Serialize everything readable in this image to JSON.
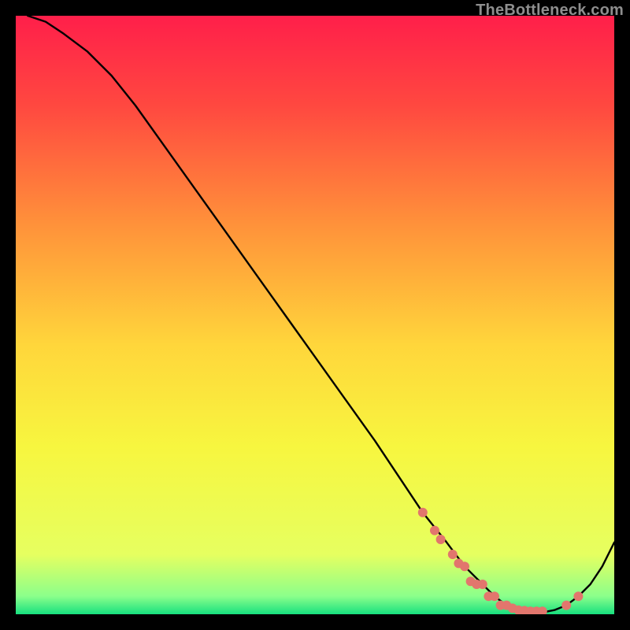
{
  "brand": "TheBottleneck.com",
  "colors": {
    "curve": "#000000",
    "marker": "#e2766d",
    "frame": "#000000"
  },
  "chart_data": {
    "type": "line",
    "title": "",
    "xlabel": "",
    "ylabel": "",
    "xlim": [
      0,
      100
    ],
    "ylim": [
      0,
      100
    ],
    "gradient_stops": [
      {
        "offset": 0.0,
        "color": "#ff1f4a"
      },
      {
        "offset": 0.15,
        "color": "#ff4840"
      },
      {
        "offset": 0.35,
        "color": "#ff923a"
      },
      {
        "offset": 0.55,
        "color": "#ffd63b"
      },
      {
        "offset": 0.72,
        "color": "#f7f63f"
      },
      {
        "offset": 0.9,
        "color": "#e6ff60"
      },
      {
        "offset": 0.97,
        "color": "#8bff8b"
      },
      {
        "offset": 1.0,
        "color": "#17e07f"
      }
    ],
    "series": [
      {
        "name": "bottleneck-curve",
        "x": [
          2,
          5,
          8,
          12,
          16,
          20,
          25,
          30,
          35,
          40,
          45,
          50,
          55,
          60,
          64,
          68,
          72,
          75,
          78,
          80,
          82,
          84,
          86,
          88,
          90,
          92,
          94,
          96,
          98,
          100
        ],
        "y": [
          100,
          99,
          97,
          94,
          90,
          85,
          78,
          71,
          64,
          57,
          50,
          43,
          36,
          29,
          23,
          17,
          12,
          8,
          5,
          3,
          1.5,
          0.7,
          0.3,
          0.3,
          0.7,
          1.5,
          3,
          5,
          8,
          12
        ]
      }
    ],
    "markers": {
      "name": "highlight-points",
      "x": [
        68,
        70,
        71,
        73,
        74,
        75,
        76,
        77,
        78,
        79,
        80,
        81,
        82,
        83,
        84,
        85,
        86,
        87,
        88,
        92,
        94
      ],
      "y": [
        17,
        14,
        12.5,
        10,
        8.5,
        8,
        5.5,
        5,
        5,
        3,
        3,
        1.5,
        1.5,
        1,
        0.7,
        0.6,
        0.5,
        0.5,
        0.5,
        1.5,
        3
      ]
    }
  }
}
